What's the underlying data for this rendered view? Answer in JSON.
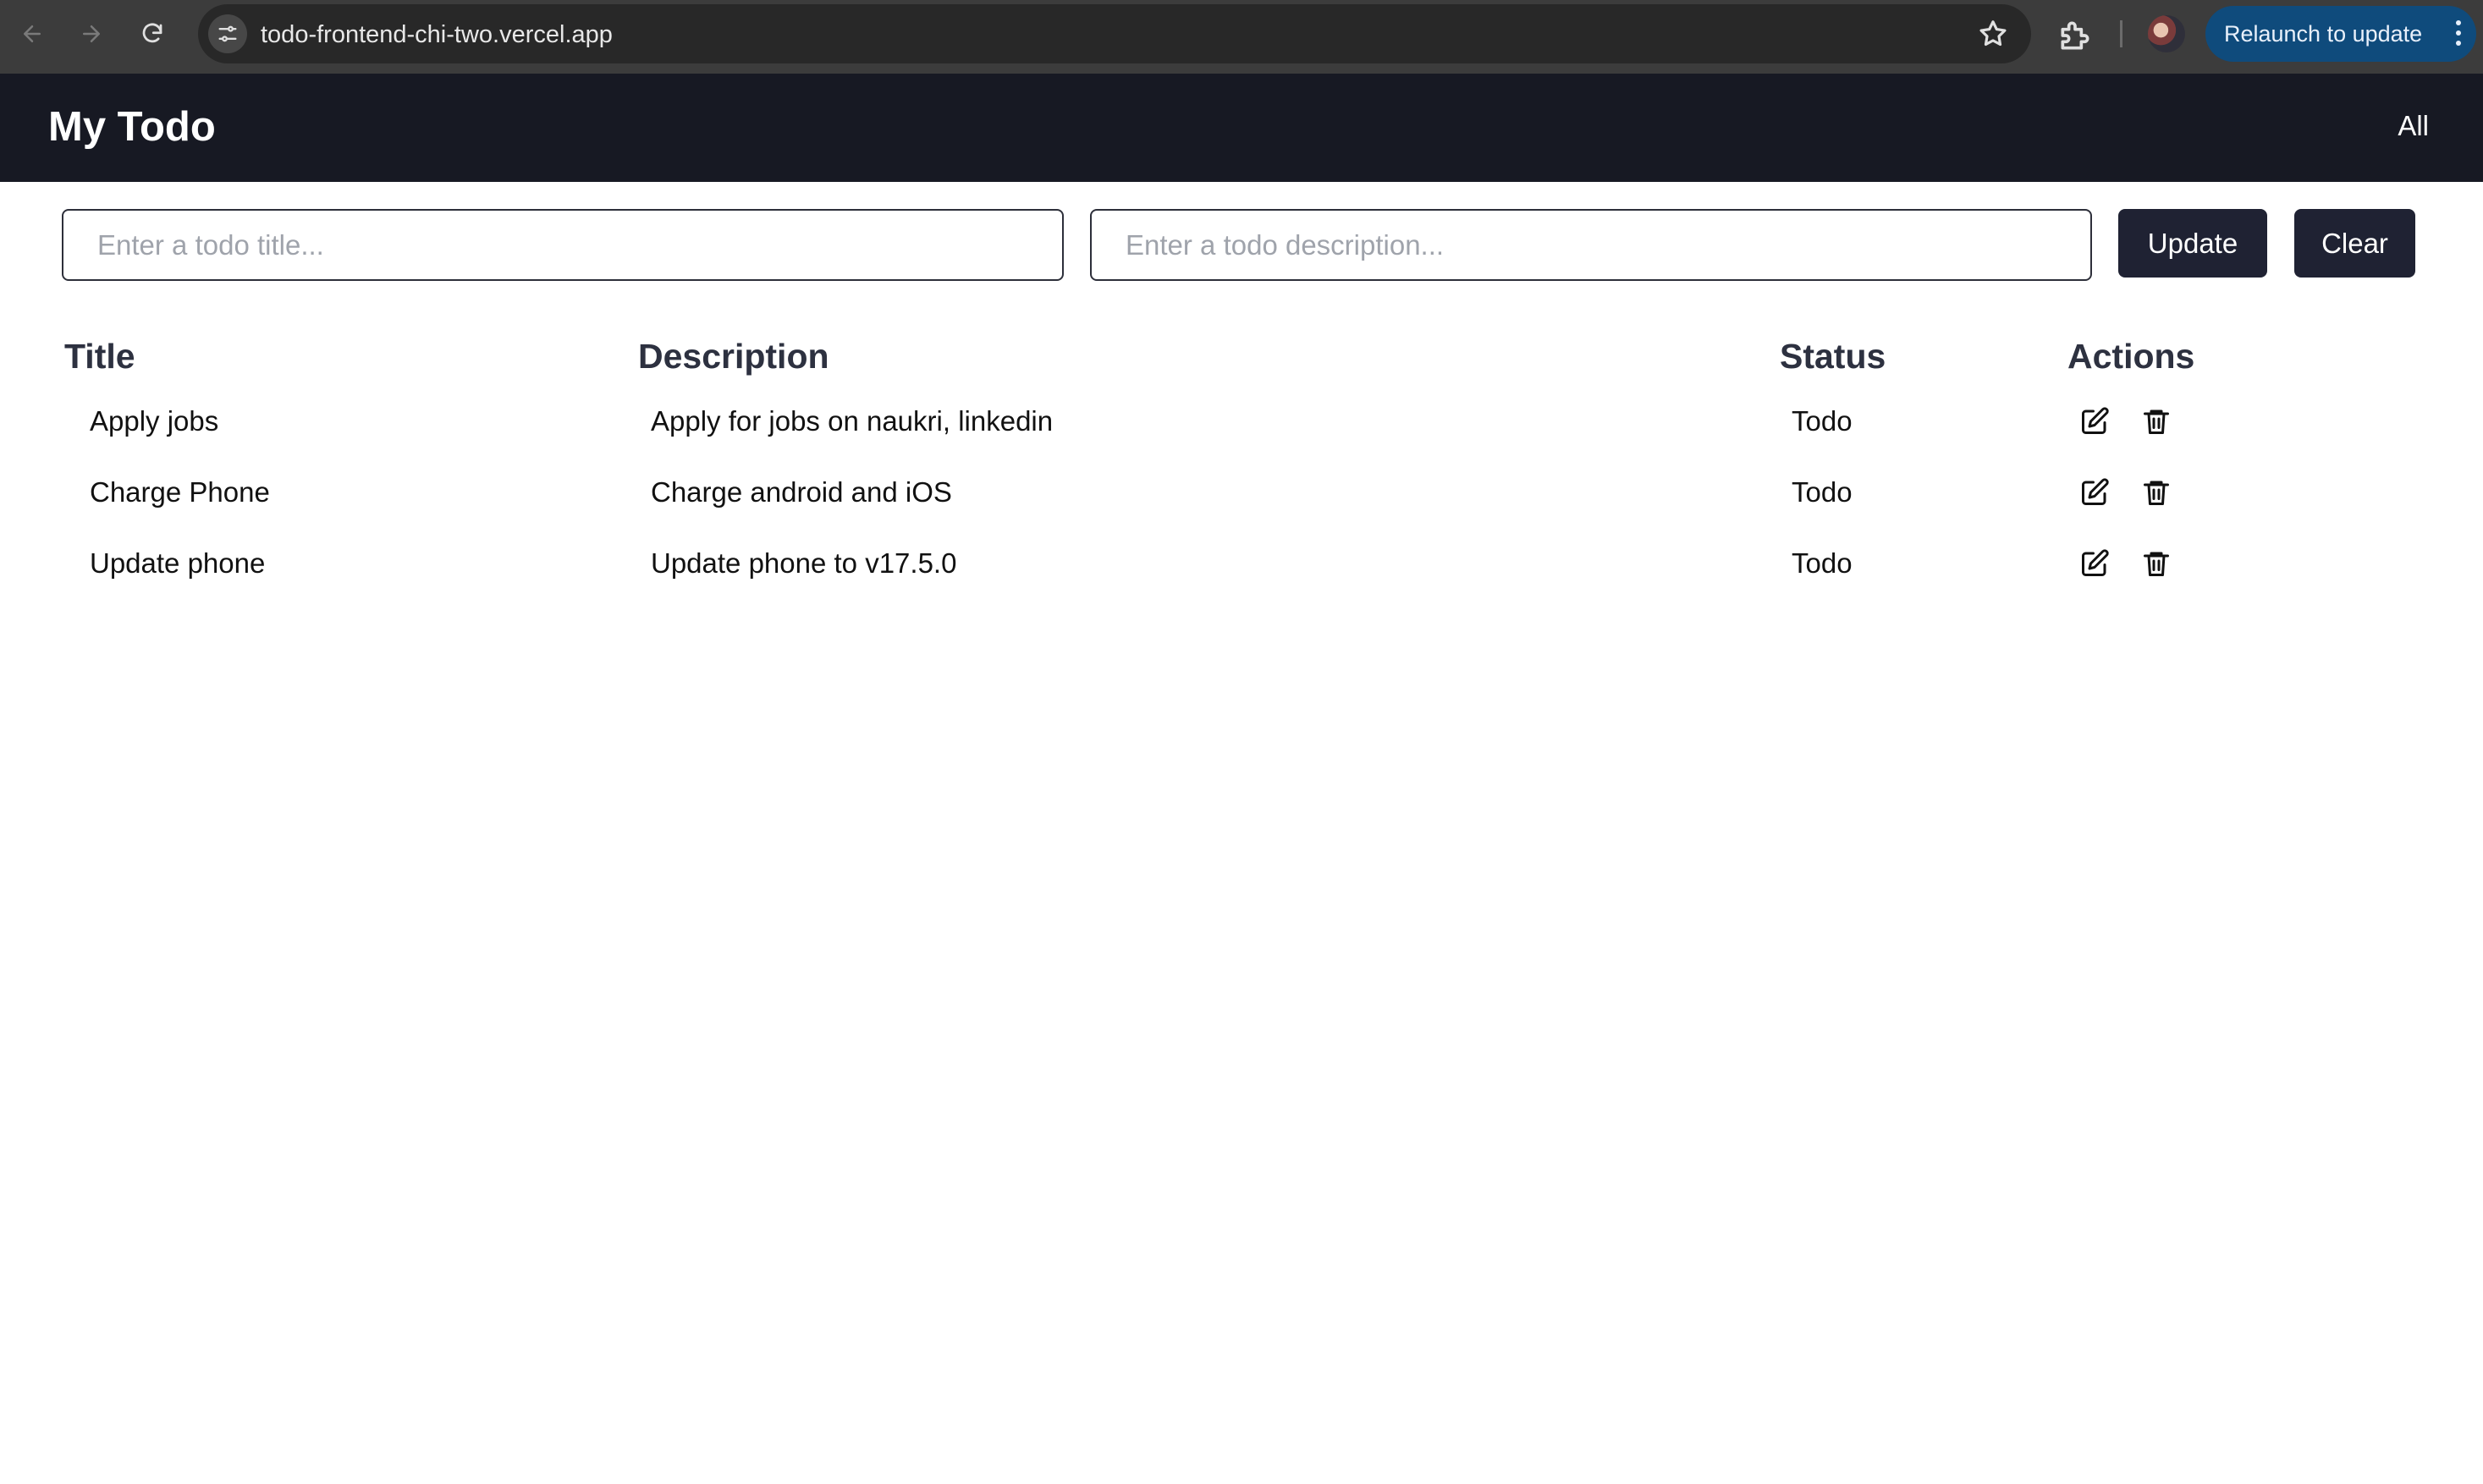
{
  "browser": {
    "url": "todo-frontend-chi-two.vercel.app",
    "relaunch_label": "Relaunch to update"
  },
  "header": {
    "title": "My Todo",
    "filter_label": "All"
  },
  "form": {
    "title_placeholder": "Enter a todo title...",
    "description_placeholder": "Enter a todo description...",
    "update_label": "Update",
    "clear_label": "Clear"
  },
  "table": {
    "columns": {
      "title": "Title",
      "description": "Description",
      "status": "Status",
      "actions": "Actions"
    },
    "rows": [
      {
        "title": "Apply jobs",
        "description": "Apply for jobs on naukri, linkedin",
        "status": "Todo"
      },
      {
        "title": "Charge Phone",
        "description": "Charge android and iOS",
        "status": "Todo"
      },
      {
        "title": "Update phone",
        "description": "Update phone to v17.5.0",
        "status": "Todo"
      }
    ]
  },
  "colors": {
    "browser_chrome": "#3c3c3c",
    "app_header": "#171923",
    "button": "#1f2233",
    "relaunch": "#0f4b7c"
  }
}
